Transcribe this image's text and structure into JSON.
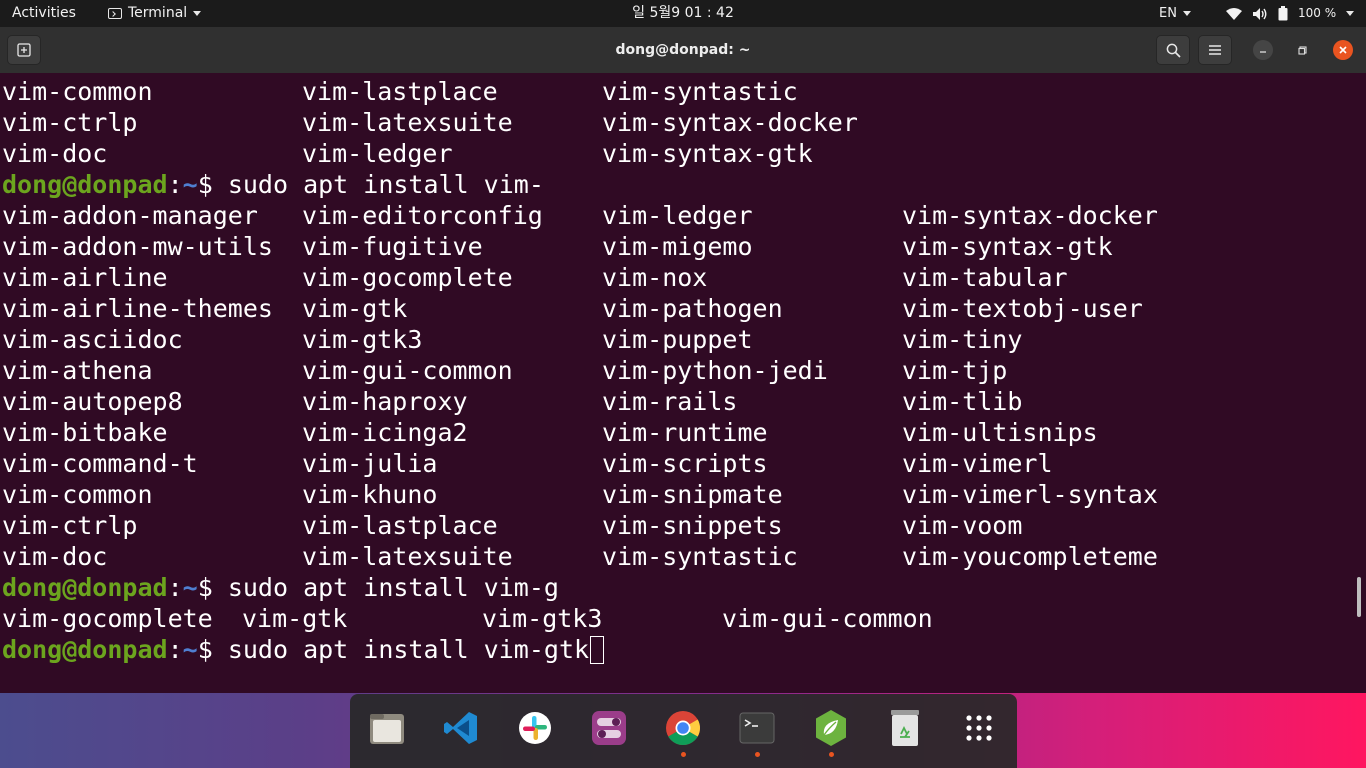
{
  "topbar": {
    "activities": "Activities",
    "app_name": "Terminal",
    "clock": "일 5월9  01 : 42",
    "language": "EN",
    "battery": "100 %"
  },
  "window": {
    "title": "dong@donpad: ~"
  },
  "terminal": {
    "prompt_user": "dong@donpad",
    "prompt_sep": ":",
    "prompt_path": "~",
    "prompt_symbol": "$ ",
    "block1": [
      [
        "vim-common",
        "vim-lastplace",
        "vim-syntastic"
      ],
      [
        "vim-ctrlp",
        "vim-latexsuite",
        "vim-syntax-docker"
      ],
      [
        "vim-doc",
        "vim-ledger",
        "vim-syntax-gtk"
      ]
    ],
    "command1": "sudo apt install vim-",
    "block2": [
      [
        "vim-addon-manager",
        "vim-editorconfig",
        "vim-ledger",
        "vim-syntax-docker"
      ],
      [
        "vim-addon-mw-utils",
        "vim-fugitive",
        "vim-migemo",
        "vim-syntax-gtk"
      ],
      [
        "vim-airline",
        "vim-gocomplete",
        "vim-nox",
        "vim-tabular"
      ],
      [
        "vim-airline-themes",
        "vim-gtk",
        "vim-pathogen",
        "vim-textobj-user"
      ],
      [
        "vim-asciidoc",
        "vim-gtk3",
        "vim-puppet",
        "vim-tiny"
      ],
      [
        "vim-athena",
        "vim-gui-common",
        "vim-python-jedi",
        "vim-tjp"
      ],
      [
        "vim-autopep8",
        "vim-haproxy",
        "vim-rails",
        "vim-tlib"
      ],
      [
        "vim-bitbake",
        "vim-icinga2",
        "vim-runtime",
        "vim-ultisnips"
      ],
      [
        "vim-command-t",
        "vim-julia",
        "vim-scripts",
        "vim-vimerl"
      ],
      [
        "vim-common",
        "vim-khuno",
        "vim-snipmate",
        "vim-vimerl-syntax"
      ],
      [
        "vim-ctrlp",
        "vim-lastplace",
        "vim-snippets",
        "vim-voom"
      ],
      [
        "vim-doc",
        "vim-latexsuite",
        "vim-syntastic",
        "vim-youcompleteme"
      ]
    ],
    "command2": "sudo apt install vim-g",
    "block3": [
      "vim-gocomplete",
      "vim-gtk",
      "vim-gtk3",
      "vim-gui-common"
    ],
    "command3": "sudo apt install vim-gtk"
  },
  "dock": {
    "items": [
      "files-icon",
      "vscode-icon",
      "slack-icon",
      "settings-toggle-icon",
      "chrome-icon",
      "terminal-icon",
      "spring-icon",
      "trash-icon",
      "show-apps-icon"
    ]
  },
  "colors": {
    "terminal_bg": "#300a24",
    "prompt_user": "#6ca51e",
    "prompt_path": "#4f7fd1",
    "accent": "#e95420"
  }
}
